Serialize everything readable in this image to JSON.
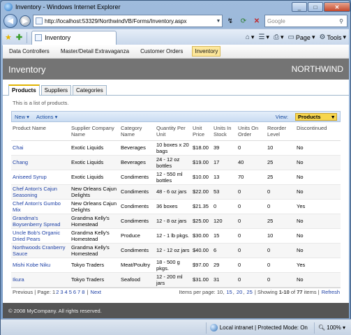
{
  "window": {
    "title": "Inventory - Windows Internet Explorer"
  },
  "address": {
    "url": "http://localhost:53329/NorthwindVB/Forms/Inventory.aspx"
  },
  "search": {
    "placeholder": "Google"
  },
  "browser_tab": {
    "label": "Inventory"
  },
  "commands": {
    "page": "Page",
    "tools": "Tools"
  },
  "menu": [
    {
      "label": "Data Controllers"
    },
    {
      "label": "Master/Detail Extravaganza"
    },
    {
      "label": "Customer Orders"
    },
    {
      "label": "Inventory"
    }
  ],
  "page": {
    "title": "Inventory",
    "brand": "NORTHWIND"
  },
  "tabs": [
    {
      "label": "Products"
    },
    {
      "label": "Suppliers"
    },
    {
      "label": "Categories"
    }
  ],
  "description": "This is a list of products.",
  "toolbar": {
    "new_label": "New",
    "actions_label": "Actions",
    "view_label": "View:",
    "view_value": "Products"
  },
  "columns": [
    "Product Name",
    "Supplier Company Name",
    "Category Name",
    "Quantity Per Unit",
    "Unit Price",
    "Units In Stock",
    "Units On Order",
    "Reorder Level",
    "Discontinued"
  ],
  "rows": [
    [
      "Chai",
      "Exotic Liquids",
      "Beverages",
      "10 boxes x 20 bags",
      "$18.00",
      "39",
      "0",
      "10",
      "No"
    ],
    [
      "Chang",
      "Exotic Liquids",
      "Beverages",
      "24 - 12 oz bottles",
      "$19.00",
      "17",
      "40",
      "25",
      "No"
    ],
    [
      "Aniseed Syrup",
      "Exotic Liquids",
      "Condiments",
      "12 - 550 ml bottles",
      "$10.00",
      "13",
      "70",
      "25",
      "No"
    ],
    [
      "Chef Anton's Cajun Seasoning",
      "New Orleans Cajun Delights",
      "Condiments",
      "48 - 6 oz jars",
      "$22.00",
      "53",
      "0",
      "0",
      "No"
    ],
    [
      "Chef Anton's Gumbo Mix",
      "New Orleans Cajun Delights",
      "Condiments",
      "36 boxes",
      "$21.35",
      "0",
      "0",
      "0",
      "Yes"
    ],
    [
      "Grandma's Boysenberry Spread",
      "Grandma Kelly's Homestead",
      "Condiments",
      "12 - 8 oz jars",
      "$25.00",
      "120",
      "0",
      "25",
      "No"
    ],
    [
      "Uncle Bob's Organic Dried Pears",
      "Grandma Kelly's Homestead",
      "Produce",
      "12 - 1 lb pkgs.",
      "$30.00",
      "15",
      "0",
      "10",
      "No"
    ],
    [
      "Northwoods Cranberry Sauce",
      "Grandma Kelly's Homestead",
      "Condiments",
      "12 - 12 oz jars",
      "$40.00",
      "6",
      "0",
      "0",
      "No"
    ],
    [
      "Mishi Kobe Niku",
      "Tokyo Traders",
      "Meat/Poultry",
      "18 - 500 g pkgs.",
      "$97.00",
      "29",
      "0",
      "0",
      "Yes"
    ],
    [
      "Ikura",
      "Tokyo Traders",
      "Seafood",
      "12 - 200 ml jars",
      "$31.00",
      "31",
      "0",
      "0",
      "No"
    ]
  ],
  "pager": {
    "previous": "Previous",
    "page_label": "| Page:",
    "pages": [
      "1",
      "2",
      "3",
      "4",
      "5",
      "6",
      "7",
      "8"
    ],
    "sep": "|",
    "next": "Next",
    "items_per_page_label": "Items per page:",
    "sizes": [
      "10",
      "15",
      "20",
      "25"
    ],
    "showing_prefix": "| Showing",
    "showing_range": "1-10",
    "of": "of",
    "total": "77",
    "items_word": "items",
    "pipe": "|",
    "refresh": "Refresh"
  },
  "footer": "© 2008 MyCompany. All rights reserved.",
  "status": {
    "zone": "Local intranet | Protected Mode: On",
    "zoom": "100%"
  }
}
